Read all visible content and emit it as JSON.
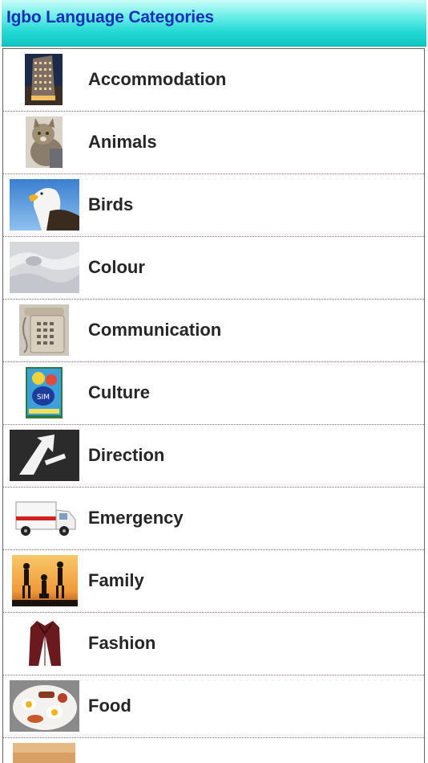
{
  "header": {
    "title": "Igbo Language Categories"
  },
  "categories": [
    {
      "label": "Accommodation",
      "icon": "building-photo-icon"
    },
    {
      "label": "Animals",
      "icon": "cat-photo-icon"
    },
    {
      "label": "Birds",
      "icon": "eagle-photo-icon"
    },
    {
      "label": "Colour",
      "icon": "white-fabric-photo-icon"
    },
    {
      "label": "Communication",
      "icon": "telephone-photo-icon"
    },
    {
      "label": "Culture",
      "icon": "book-cover-photo-icon"
    },
    {
      "label": "Direction",
      "icon": "road-arrow-photo-icon"
    },
    {
      "label": "Emergency",
      "icon": "ambulance-photo-icon"
    },
    {
      "label": "Family",
      "icon": "family-silhouette-photo-icon"
    },
    {
      "label": "Fashion",
      "icon": "leather-jacket-photo-icon"
    },
    {
      "label": "Food",
      "icon": "breakfast-plate-photo-icon"
    },
    {
      "label": "",
      "icon": "partial-photo-icon"
    }
  ]
}
